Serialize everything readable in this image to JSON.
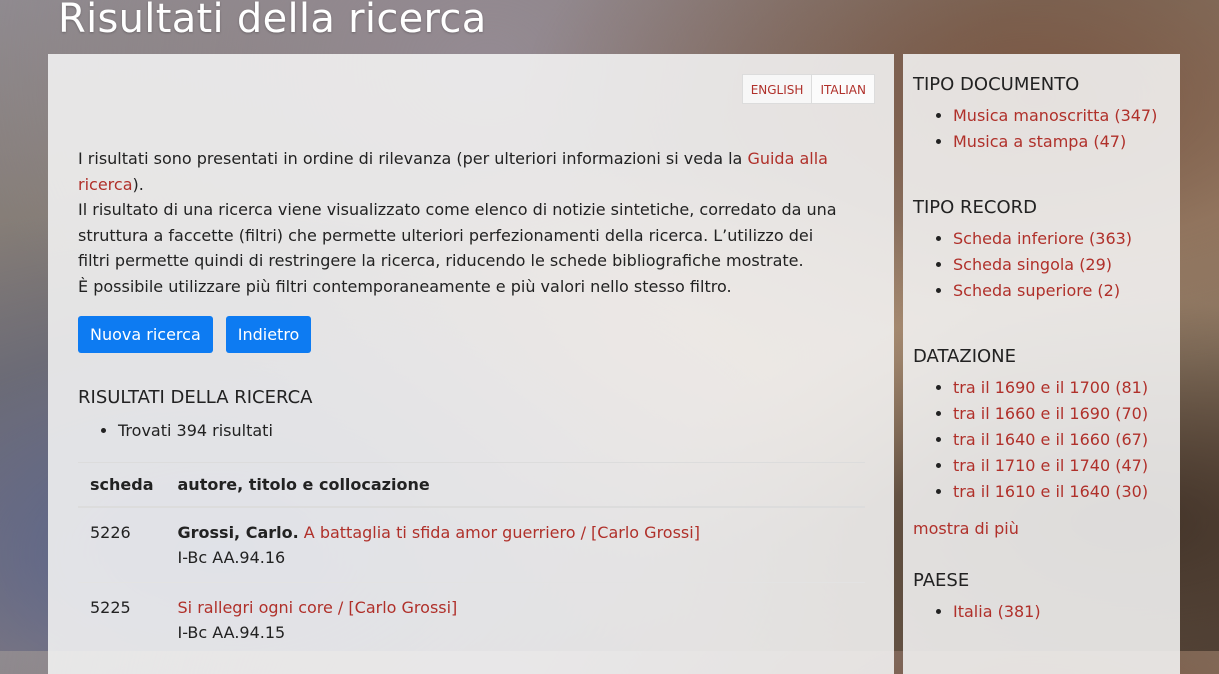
{
  "page": {
    "title": "Risultati della ricerca"
  },
  "lang": {
    "english": "ENGLISH",
    "italian": "ITALIAN"
  },
  "intro": {
    "p1_before": "I risultati sono presentati in ordine di rilevanza (per ulteriori informazioni si veda la ",
    "p1_link": "Guida alla ricerca",
    "p1_after": ").",
    "p2": "Il risultato di una ricerca viene visualizzato come elenco di notizie sintetiche, corredato da una struttura a faccette (filtri) che permette ulteriori perfezionamenti della ricerca. L’utilizzo dei filtri permette quindi di restringere la ricerca, riducendo le schede bibliografiche mostrate.",
    "p3": "È possibile utilizzare più filtri contemporaneamente e più valori nello stesso filtro."
  },
  "buttons": {
    "new_search": "Nuova ricerca",
    "back": "Indietro"
  },
  "results": {
    "heading": "RISULTATI DELLA RICERCA",
    "count_text": "Trovati 394 risultati",
    "columns": {
      "scheda": "scheda",
      "details": "autore, titolo e collocazione"
    },
    "rows": [
      {
        "scheda": "5226",
        "author": "Grossi, Carlo.",
        "title": "A battaglia ti sfida amor guerriero / [Carlo Grossi]",
        "location": "I-Bc AA.94.16"
      },
      {
        "scheda": "5225",
        "author": "",
        "title": "Si rallegri ogni core / [Carlo Grossi]",
        "location": "I-Bc AA.94.15"
      }
    ]
  },
  "sidebar": {
    "tipo_documento": {
      "title": "TIPO DOCUMENTO",
      "items": [
        "Musica manoscritta (347)",
        "Musica a stampa (47)"
      ]
    },
    "tipo_record": {
      "title": "TIPO RECORD",
      "items": [
        "Scheda inferiore (363)",
        "Scheda singola (29)",
        "Scheda superiore (2)"
      ]
    },
    "datazione": {
      "title": "DATAZIONE",
      "items": [
        "tra il 1690 e il 1700 (81)",
        "tra il 1660 e il 1690 (70)",
        "tra il 1640 e il 1660 (67)",
        "tra il 1710 e il 1740 (47)",
        "tra il 1610 e il 1640 (30)"
      ],
      "more": "mostra di più"
    },
    "paese": {
      "title": "PAESE",
      "items": [
        "Italia (381)"
      ]
    }
  },
  "colors": {
    "link": "#b0302a",
    "button": "#0d7bf2"
  }
}
